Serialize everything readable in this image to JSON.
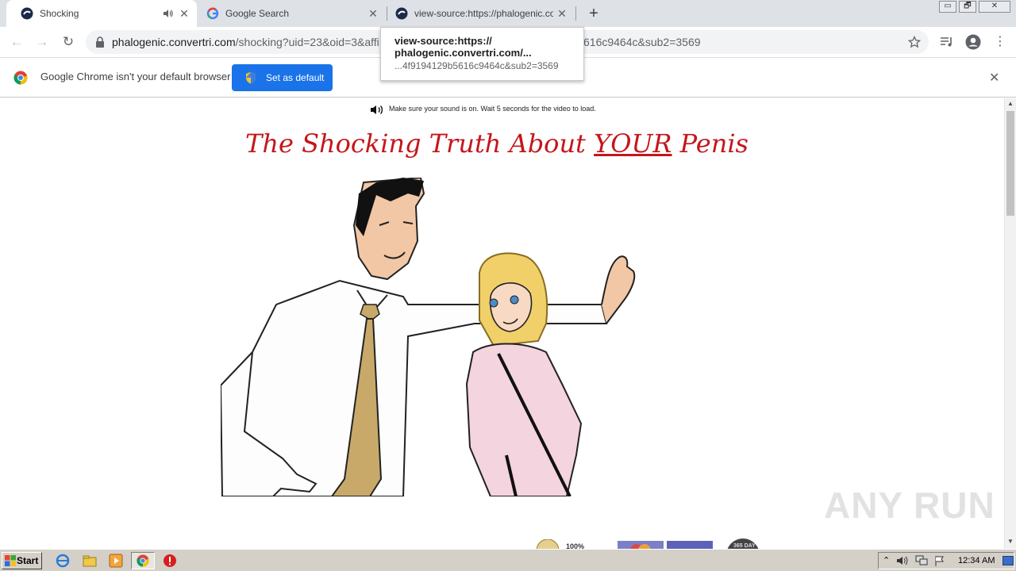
{
  "browser": {
    "tabs": [
      {
        "title": "Shocking",
        "active": true
      },
      {
        "title": "Google Search",
        "active": false
      },
      {
        "title": "view-source:https://phalogenic.conv",
        "active": false
      }
    ],
    "new_tab": "+",
    "window_controls": {
      "minimize": "▭",
      "restore": "🗗",
      "close": "✕"
    },
    "address": {
      "host": "phalogenic.convertri.com",
      "path": "/shocking?uid=23&oid=3&affi",
      "tail": "616c9464c&sub2=3569"
    },
    "tooltip": {
      "line1": "view-source:https://",
      "line2": "phalogenic.convertri.com/...",
      "line3": "...4f9194129b5616c9464c&sub2=3569"
    }
  },
  "infobar": {
    "message": "Google Chrome isn't your default browser",
    "button": "Set as default",
    "close": "✕"
  },
  "page": {
    "sound_note": "Make sure your sound is on. Wait 5 seconds for the video to load.",
    "headline_pre": "The Shocking Truth About ",
    "headline_emph": "YOUR",
    "headline_post": " Penis",
    "badge_text": "100%",
    "badge2_text": "365 DAY"
  },
  "watermark": "ANY RUN",
  "taskbar": {
    "start": "Start",
    "clock": "12:34 AM"
  },
  "colors": {
    "headline": "#c4161c",
    "chrome_blue": "#1a73e8",
    "tabstrip": "#dee1e6",
    "taskbar": "#d4d0c8"
  }
}
